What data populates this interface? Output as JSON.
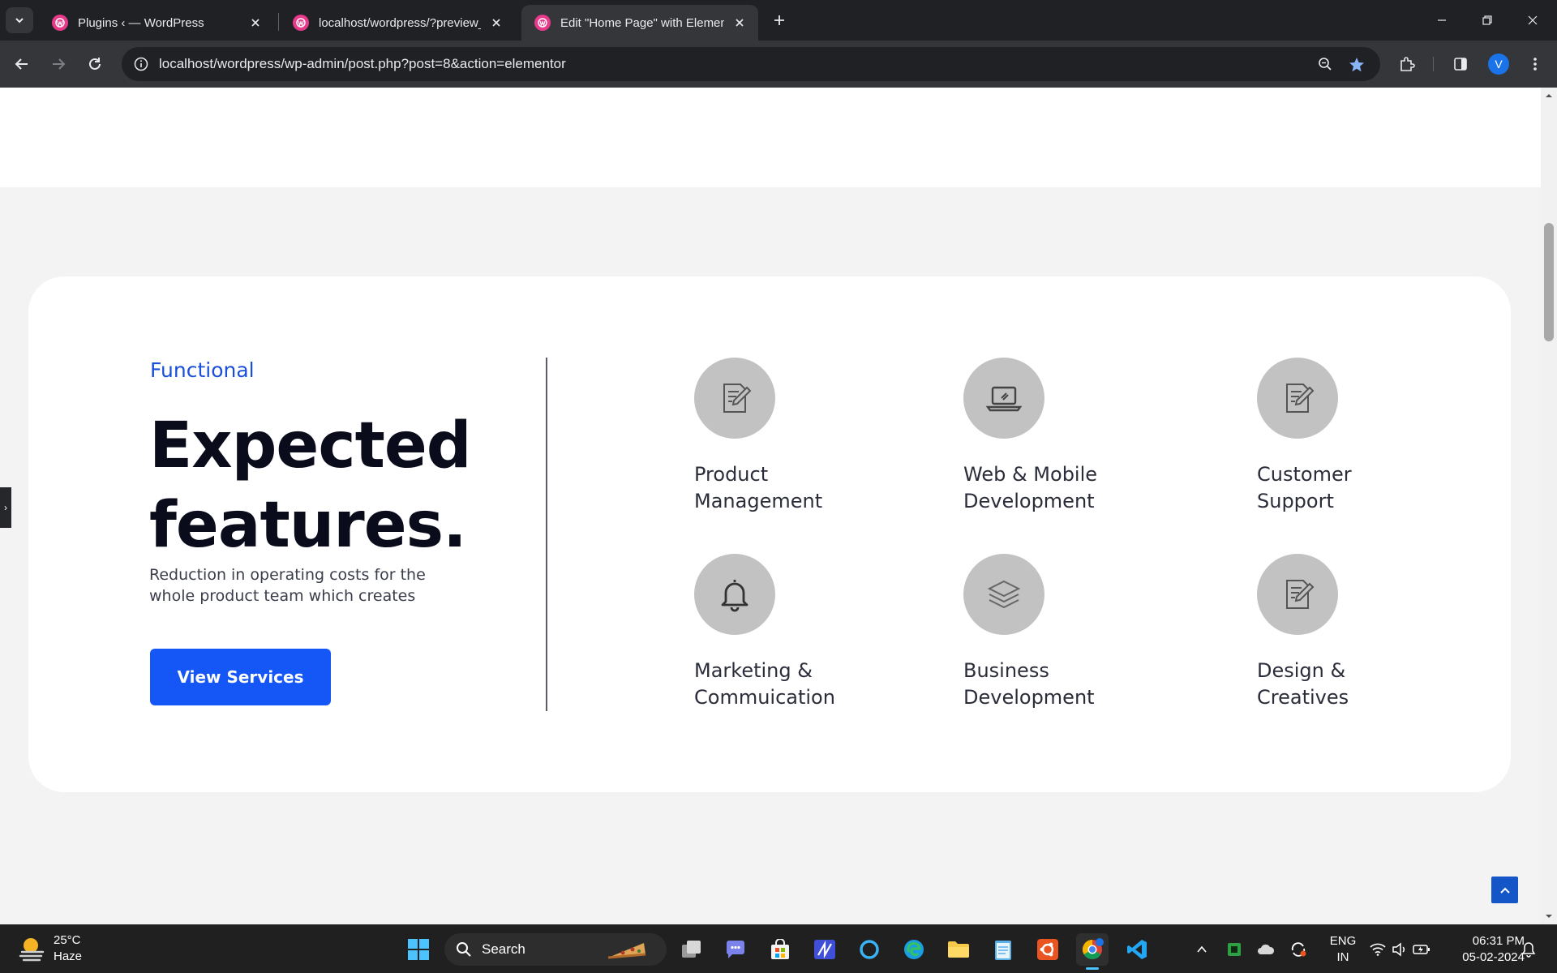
{
  "browser": {
    "tabs": [
      {
        "title": "Plugins ‹ — WordPress",
        "active": false
      },
      {
        "title": "localhost/wordpress/?preview_i",
        "active": false
      },
      {
        "title": "Edit \"Home Page\" with Element",
        "active": true
      }
    ],
    "url": "localhost/wordpress/wp-admin/post.php?post=8&action=elementor",
    "profile_initial": "V",
    "accent": "#e83a8a"
  },
  "section": {
    "eyebrow": "Functional",
    "heading_line1": "Expected",
    "heading_line2": "features.",
    "description": "Reduction in operating costs for the whole product team which creates",
    "cta_label": "View Services",
    "cta_color": "#1456f6",
    "eyebrow_color": "#1a4fd8"
  },
  "features": [
    {
      "icon": "document-edit-icon",
      "line1": "Product",
      "line2": "Management"
    },
    {
      "icon": "laptop-icon",
      "line1": "Web & Mobile",
      "line2": "Development"
    },
    {
      "icon": "document-edit-icon",
      "line1": "Customer",
      "line2": "Support"
    },
    {
      "icon": "bell-icon",
      "line1": "Marketing &",
      "line2": "Commuication"
    },
    {
      "icon": "layers-icon",
      "line1": "Business",
      "line2": "Development"
    },
    {
      "icon": "document-edit-icon",
      "line1": "Design &",
      "line2": "Creatives"
    }
  ],
  "taskbar": {
    "weather_temp": "25°C",
    "weather_desc": "Haze",
    "search_label": "Search",
    "lang_line1": "ENG",
    "lang_line2": "IN",
    "time": "06:31 PM",
    "date": "05-02-2024"
  }
}
